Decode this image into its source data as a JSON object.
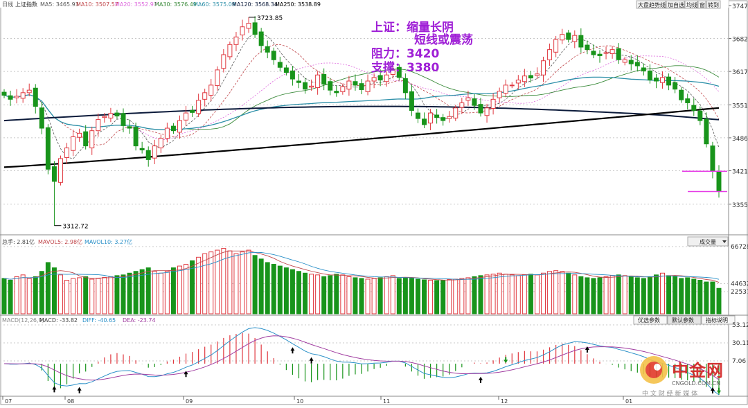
{
  "colors": {
    "up": "#e0383f",
    "down": "#18941b",
    "ma5": "#555555",
    "ma10": "#c0464a",
    "ma20": "#dd66dd",
    "ma30": "#3a8a3a",
    "ma60": "#2c8fa8",
    "ma120": "#0b1a3a",
    "ma250": "#000000",
    "annotation": "#9f1fd6",
    "grid": "#c8c8c8",
    "support": "#e63ce6",
    "dif": "#2a90c8",
    "dea": "#a03ca0",
    "watermark": "#d22020"
  },
  "price_panel": {
    "period_label": "日线",
    "index_name": "上证指数",
    "ma_legend": [
      {
        "text": "MA5: 3465.93",
        "color": "#555555"
      },
      {
        "text": "MA10: 3507.57",
        "color": "#c0464a"
      },
      {
        "text": "MA20: 3552.97",
        "color": "#dd66dd"
      },
      {
        "text": "MA30: 3576.49",
        "color": "#3a8a3a"
      },
      {
        "text": "MA60: 3575.09",
        "color": "#2c8fa8"
      },
      {
        "text": "MA120: 3568.34",
        "color": "#0b1a3a"
      },
      {
        "text": "MA250: 3538.89",
        "color": "#000000"
      }
    ],
    "buttons": [
      "大盘趋势线",
      "加自选",
      "均线",
      "窗",
      "转到"
    ],
    "high_label": "3723.85",
    "low_label": "3312.72",
    "y_ticks": [
      "3747",
      "3682",
      "3617",
      "3551",
      "3486",
      "3421",
      "3355"
    ]
  },
  "annotation": {
    "line1": "上证：缩量长阴",
    "line2": "短线或震荡",
    "line3": "阻力：3420",
    "line4": "支撑：3380"
  },
  "volume_panel": {
    "legend": [
      {
        "text": "总手: 2.81亿",
        "color": "#444444"
      },
      {
        "text": "MAVOL5: 2.98亿",
        "color": "#c0464a"
      },
      {
        "text": "MAVOL10: 3.27亿",
        "color": "#2a90c8"
      }
    ],
    "selector": "成交量",
    "y_ticks": [
      "66728",
      "44632",
      "22537"
    ]
  },
  "macd_panel": {
    "legend": [
      {
        "text": "MACD(12,26,9)",
        "color": "#888888"
      },
      {
        "text": "MACD: -33.82",
        "color": "#444444"
      },
      {
        "text": "DIFF: -40.65",
        "color": "#2a90c8"
      },
      {
        "text": "DEA: -23.74",
        "color": "#a03ca0"
      }
    ],
    "tabs": [
      "优选参数",
      "默认参数",
      "指标说明"
    ],
    "active_tab": 1,
    "y_ticks": [
      "53.12",
      "30.11",
      "7.06"
    ]
  },
  "x_axis": {
    "labels": [
      "07",
      "08",
      "09",
      "10",
      "11",
      "12",
      "01"
    ]
  },
  "watermark": {
    "brand": "中金网",
    "domain": "CNGOLD.COM.CN",
    "slogan": "中 文 财 经 新 媒 体"
  },
  "chart_data": {
    "type": "candlestick",
    "ylim": [
      3312.72,
      3723.85
    ],
    "high": 3723.85,
    "low": 3312.72,
    "resistance": 3420,
    "support": 3380,
    "last_close": 3380,
    "moving_averages": {
      "MA5": 3465.93,
      "MA10": 3507.57,
      "MA20": 3552.97,
      "MA30": 3576.49,
      "MA60": 3575.09,
      "MA120": 3568.34,
      "MA250": 3538.89
    },
    "volume_last": "2.81亿",
    "volume_ma5": "2.98亿",
    "volume_ma10": "3.27亿",
    "macd": {
      "MACD": -33.82,
      "DIFF": -40.65,
      "DEA": -23.74
    },
    "closes": [
      3570,
      3562,
      3568,
      3575,
      3580,
      3548,
      3505,
      3424,
      3400,
      3445,
      3466,
      3488,
      3495,
      3470,
      3500,
      3522,
      3528,
      3534,
      3529,
      3510,
      3505,
      3470,
      3462,
      3443,
      3470,
      3485,
      3505,
      3500,
      3520,
      3535,
      3536,
      3560,
      3575,
      3590,
      3620,
      3650,
      3670,
      3685,
      3705,
      3712,
      3690,
      3668,
      3655,
      3640,
      3625,
      3615,
      3602,
      3595,
      3582,
      3588,
      3610,
      3592,
      3580,
      3575,
      3587,
      3598,
      3590,
      3581,
      3598,
      3605,
      3600,
      3610,
      3620,
      3605,
      3575,
      3540,
      3524,
      3512,
      3535,
      3526,
      3520,
      3528,
      3545,
      3555,
      3565,
      3550,
      3535,
      3545,
      3562,
      3578,
      3590,
      3590,
      3600,
      3608,
      3604,
      3612,
      3638,
      3660,
      3680,
      3690,
      3680,
      3688,
      3665,
      3660,
      3650,
      3648,
      3654,
      3660,
      3640,
      3640,
      3632,
      3628,
      3618,
      3600,
      3598,
      3605,
      3590,
      3582,
      3561,
      3555,
      3540,
      3520,
      3474,
      3420,
      3380
    ],
    "volume": [
      1.0,
      0.95,
      1.05,
      1.1,
      1.0,
      1.05,
      1.2,
      1.45,
      1.3,
      1.1,
      0.95,
      1.0,
      1.02,
      1.05,
      0.98,
      1.0,
      1.03,
      1.05,
      1.08,
      1.1,
      1.15,
      1.2,
      1.25,
      1.3,
      1.2,
      1.15,
      1.2,
      1.3,
      1.35,
      1.4,
      1.5,
      1.6,
      1.7,
      1.75,
      1.8,
      1.85,
      1.78,
      1.7,
      1.75,
      1.8,
      1.65,
      1.55,
      1.45,
      1.4,
      1.35,
      1.3,
      1.25,
      1.2,
      1.15,
      1.12,
      1.1,
      1.05,
      1.08,
      1.12,
      1.1,
      1.05,
      1.02,
      1.0,
      0.98,
      1.0,
      1.02,
      1.05,
      1.08,
      1.0,
      1.02,
      1.0,
      0.98,
      0.96,
      0.95,
      0.94,
      0.95,
      0.97,
      0.98,
      1.0,
      1.02,
      1.05,
      1.08,
      1.1,
      1.12,
      1.15,
      1.12,
      1.1,
      1.08,
      1.1,
      1.12,
      1.1,
      1.15,
      1.2,
      1.22,
      1.2,
      1.15,
      1.1,
      1.05,
      1.02,
      1.0,
      1.02,
      1.05,
      1.08,
      1.1,
      1.08,
      1.05,
      1.02,
      1.0,
      1.05,
      1.1,
      1.15,
      1.08,
      1.05,
      1.0,
      1.02,
      0.98,
      0.95,
      0.9,
      0.9,
      0.72
    ]
  }
}
